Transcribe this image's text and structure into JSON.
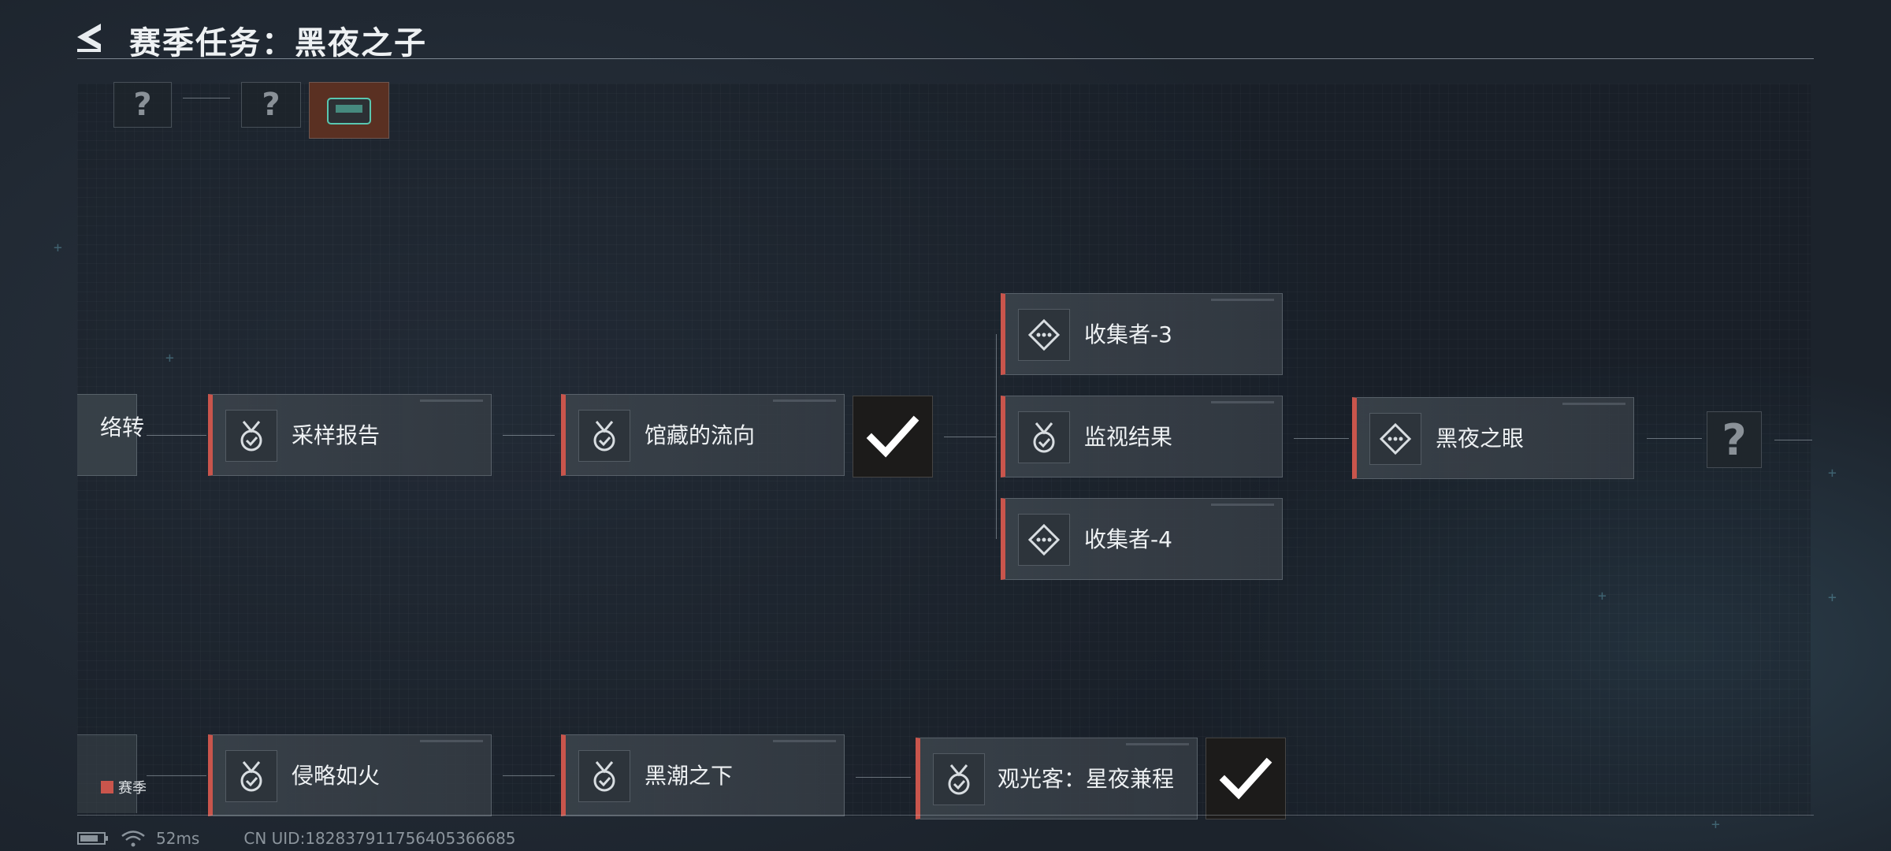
{
  "header": {
    "title": "赛季任务：黑夜之子"
  },
  "top_row": {
    "lock_glyph": "?"
  },
  "tasks": {
    "left_partial": "络转",
    "caiyang": "采样报告",
    "guancang": "馆藏的流向",
    "shouji3": "收集者-3",
    "jianshi": "监视结果",
    "shouji4": "收集者-4",
    "heiye": "黑夜之眼",
    "qinlue": "侵略如火",
    "heichao": "黑潮之下",
    "guanguang": "观光客：星夜兼程"
  },
  "locked": {
    "glyph": "?"
  },
  "legend": {
    "season_label": "赛季",
    "season_color": "#c9554c"
  },
  "status": {
    "ping": "52ms",
    "uid": "CN UID:182837911756405366685"
  },
  "colors": {
    "accent": "#c9554c",
    "check": "#ffffff"
  },
  "icons": {
    "task_medal": "medal-check-icon",
    "task_collect": "diamond-dots-icon",
    "completed": "checkmark-icon",
    "back": "back-arrow-icon"
  }
}
